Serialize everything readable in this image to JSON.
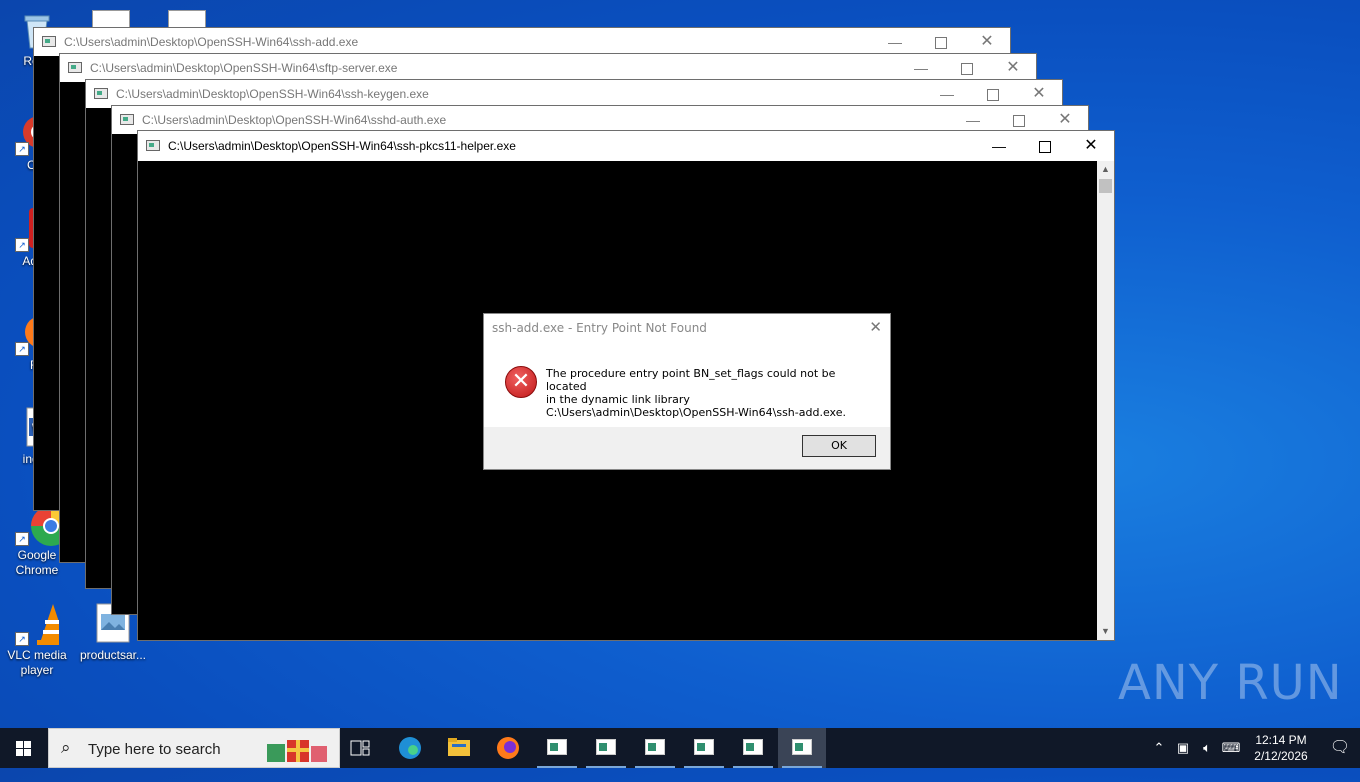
{
  "desktop": {
    "icons": [
      {
        "label": "Recy",
        "icon": "recycle-bin-icon"
      },
      {
        "label": "CCl",
        "icon": "ccleaner-icon"
      },
      {
        "label": "Ad Acr",
        "icon": "adobe-acrobat-icon"
      },
      {
        "label": "Fir",
        "icon": "firefox-icon"
      },
      {
        "label": "index",
        "icon": "word-document-icon"
      },
      {
        "label": "Google Chrome",
        "icon": "chrome-icon"
      },
      {
        "label": "VLC media player",
        "icon": "vlc-icon"
      },
      {
        "label": "productsar...",
        "icon": "image-file-icon"
      }
    ],
    "watermark": "ANY RUN"
  },
  "windows": [
    {
      "title": "C:\\Users\\admin\\Desktop\\OpenSSH-Win64\\ssh-add.exe"
    },
    {
      "title": "C:\\Users\\admin\\Desktop\\OpenSSH-Win64\\sftp-server.exe"
    },
    {
      "title": "C:\\Users\\admin\\Desktop\\OpenSSH-Win64\\ssh-keygen.exe"
    },
    {
      "title": "C:\\Users\\admin\\Desktop\\OpenSSH-Win64\\sshd-auth.exe"
    },
    {
      "title": "C:\\Users\\admin\\Desktop\\OpenSSH-Win64\\ssh-pkcs11-helper.exe"
    }
  ],
  "window_controls": {
    "minimize": "—",
    "close": "✕"
  },
  "dialog": {
    "title": "ssh-add.exe - Entry Point Not Found",
    "close": "✕",
    "icon": "error-icon",
    "message_line1": "The procedure entry point BN_set_flags could not be located",
    "message_line2": "in the dynamic link library",
    "message_line3": "C:\\Users\\admin\\Desktop\\OpenSSH-Win64\\ssh-add.exe.",
    "ok_label": "OK"
  },
  "taskbar": {
    "search_placeholder": "Type here to search",
    "time": "12:14 PM",
    "date": "2/12/2026",
    "colors": {
      "background": "#101828",
      "accent": "#7aa7d8"
    }
  }
}
